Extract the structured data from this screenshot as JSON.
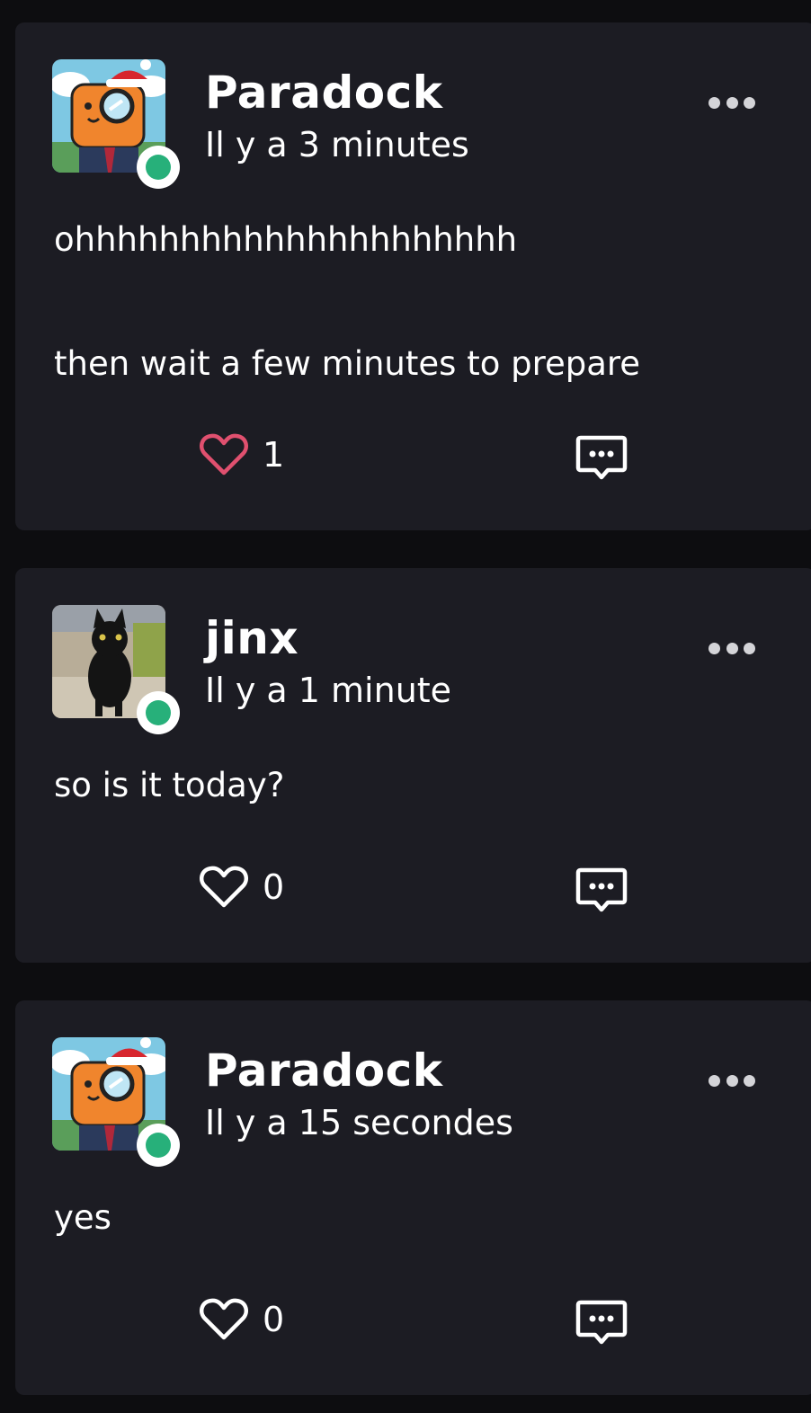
{
  "colors": {
    "background": "#0d0d10",
    "card": "#1c1c23",
    "online": "#27b07a",
    "liked": "#e0506f"
  },
  "posts": [
    {
      "author": "Paradock",
      "time": "Il y a 3 minutes",
      "avatar_icon": "orange-monocle-mascot-with-santa-hat",
      "body": "ohhhhhhhhhhhhhhhhhhhhh\n\n\nthen wait a few minutes to prepare",
      "likes": "1",
      "liked": true
    },
    {
      "author": "jinx",
      "time": "Il y a 1 minute",
      "avatar_icon": "black-cat-photo",
      "body": "so is it today?",
      "likes": "0",
      "liked": false
    },
    {
      "author": "Paradock",
      "time": "Il y a 15 secondes",
      "avatar_icon": "orange-monocle-mascot-with-santa-hat",
      "body": "yes",
      "likes": "0",
      "liked": false
    }
  ]
}
